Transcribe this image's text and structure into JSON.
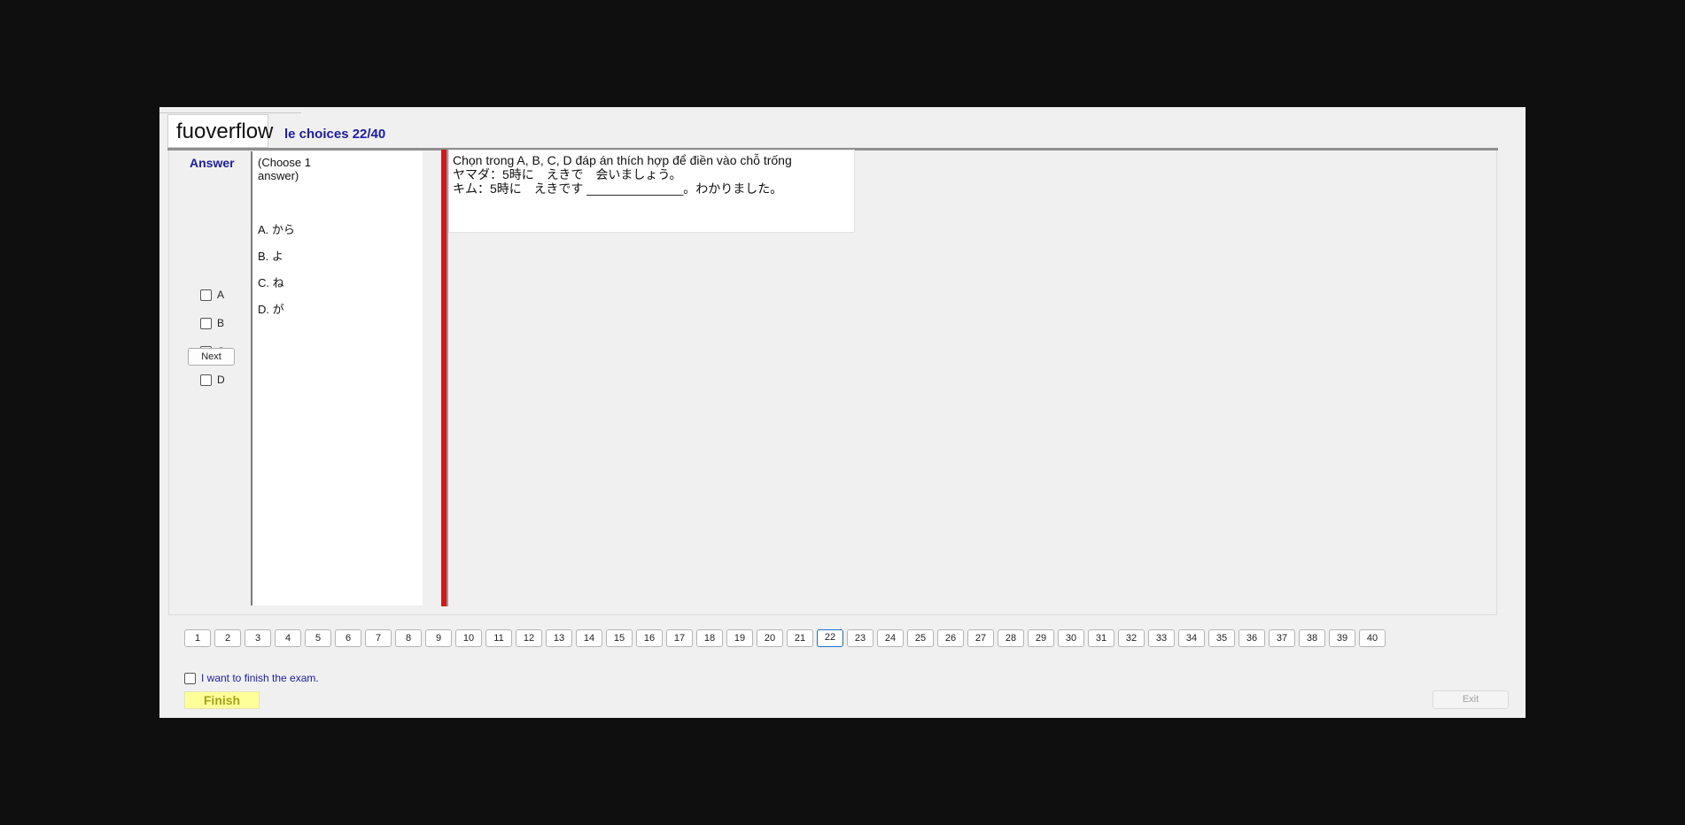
{
  "brand": "fuoverflow",
  "heading": "le choices 22/40",
  "answer_panel": {
    "title": "Answer",
    "options": [
      "A",
      "B",
      "C",
      "D"
    ],
    "next_label": "Next"
  },
  "choices_panel": {
    "instruction": "(Choose 1 answer)",
    "choices": [
      "A.  から",
      "B.  よ",
      "C.  ね",
      "D.  が"
    ]
  },
  "question": {
    "lines": [
      "Chọn trong A, B, C, D đáp án thích hợp để điền vào chỗ trống",
      "ヤマダ：5時に　えきで　会いましょう。",
      "キム：5時に　えきです ______________。わかりました。"
    ]
  },
  "pagination": {
    "pages": [
      "1",
      "2",
      "3",
      "4",
      "5",
      "6",
      "7",
      "8",
      "9",
      "10",
      "11",
      "12",
      "13",
      "14",
      "15",
      "16",
      "17",
      "18",
      "19",
      "20",
      "21",
      "22",
      "23",
      "24",
      "25",
      "26",
      "27",
      "28",
      "29",
      "30",
      "31",
      "32",
      "33",
      "34",
      "35",
      "36",
      "37",
      "38",
      "39",
      "40"
    ],
    "current": "22"
  },
  "finish": {
    "checkbox_label": "I want to finish the exam.",
    "finish_label": "Finish",
    "exit_label": "Exit"
  },
  "colors": {
    "accent": "#1c1ca4",
    "divider_red": "#cf1a1a",
    "finish_bg": "#ffff9a",
    "finish_text": "#a4a41a",
    "active_page_border": "#1e6fd0"
  }
}
